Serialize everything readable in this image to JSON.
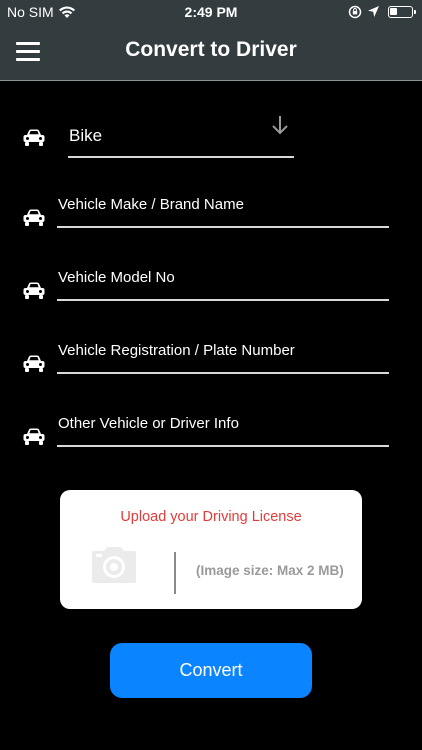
{
  "status_bar": {
    "carrier": "No SIM",
    "time": "2:49 PM"
  },
  "header": {
    "title": "Convert to Driver"
  },
  "form": {
    "vehicle_type": {
      "value": "Bike"
    },
    "fields": [
      {
        "placeholder": "Vehicle Make / Brand Name"
      },
      {
        "placeholder": "Vehicle Model No"
      },
      {
        "placeholder": "Vehicle Registration / Plate Number"
      },
      {
        "placeholder": "Other Vehicle or Driver Info"
      }
    ]
  },
  "upload": {
    "title": "Upload your Driving License",
    "size_note": "(Image size: Max 2 MB)"
  },
  "actions": {
    "convert_label": "Convert"
  },
  "colors": {
    "header_bg": "#333c3f",
    "background": "#000000",
    "accent_blue": "#0b84ff",
    "upload_title_red": "#e23b3b"
  }
}
